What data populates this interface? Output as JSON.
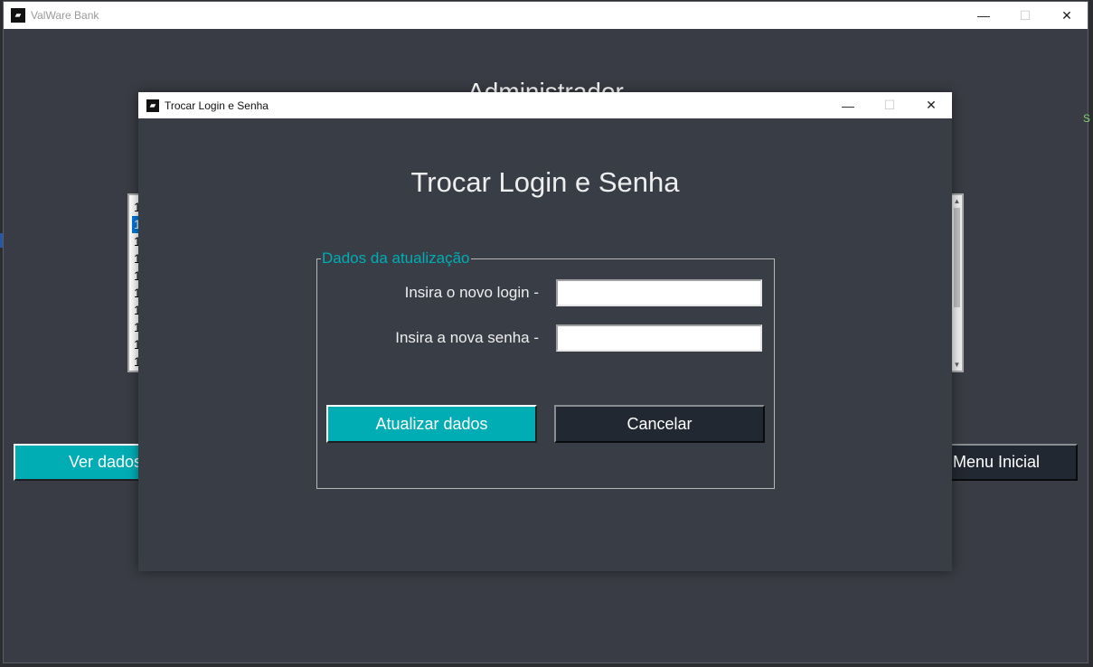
{
  "main_window": {
    "title": "ValWare Bank",
    "heading": "Administrador",
    "list_rows": [
      "1",
      "1",
      "1",
      "1",
      "1",
      "1",
      "1",
      "1",
      "1",
      "1"
    ],
    "selected_row": 1,
    "ver_dados_label": "Ver dados",
    "menu_inicial_label": "Menu Inicial",
    "edge_text": "S"
  },
  "dialog": {
    "title": "Trocar Login e Senha",
    "heading": "Trocar Login e Senha",
    "group_label": "Dados da atualização",
    "login_label": "Insira o novo login -",
    "login_value": "",
    "senha_label": "Insira a nova senha -",
    "senha_value": "",
    "update_button": "Atualizar dados",
    "cancel_button": "Cancelar"
  },
  "icons": {
    "minimize": "minimize-icon",
    "maximize": "maximize-icon",
    "close": "close-icon",
    "app": "app-icon"
  },
  "colors": {
    "accent": "#00adb5",
    "background": "#393e46",
    "dark_button": "#222831",
    "selection": "#0078d7"
  }
}
